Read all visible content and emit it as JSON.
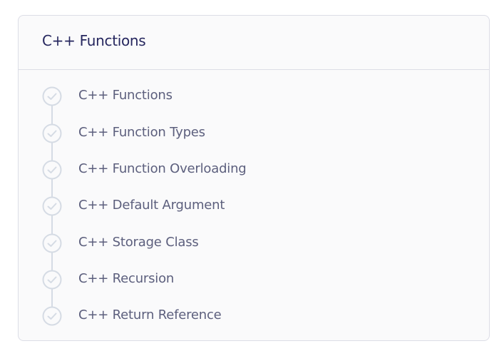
{
  "header": {
    "title": "C++ Functions"
  },
  "lessons": [
    {
      "label": "C++ Functions",
      "icon": "check-circle-icon"
    },
    {
      "label": "C++ Function Types",
      "icon": "check-circle-icon"
    },
    {
      "label": "C++ Function Overloading",
      "icon": "check-circle-icon"
    },
    {
      "label": "C++ Default Argument",
      "icon": "check-circle-icon"
    },
    {
      "label": "C++ Storage Class",
      "icon": "check-circle-icon"
    },
    {
      "label": "C++ Recursion",
      "icon": "check-circle-icon"
    },
    {
      "label": "C++ Return Reference",
      "icon": "check-circle-icon"
    }
  ],
  "colors": {
    "title": "#25265e",
    "label": "#5c5f7d",
    "icon": "#d5dbe4",
    "border": "#dcdde6",
    "background": "#fafafb"
  }
}
